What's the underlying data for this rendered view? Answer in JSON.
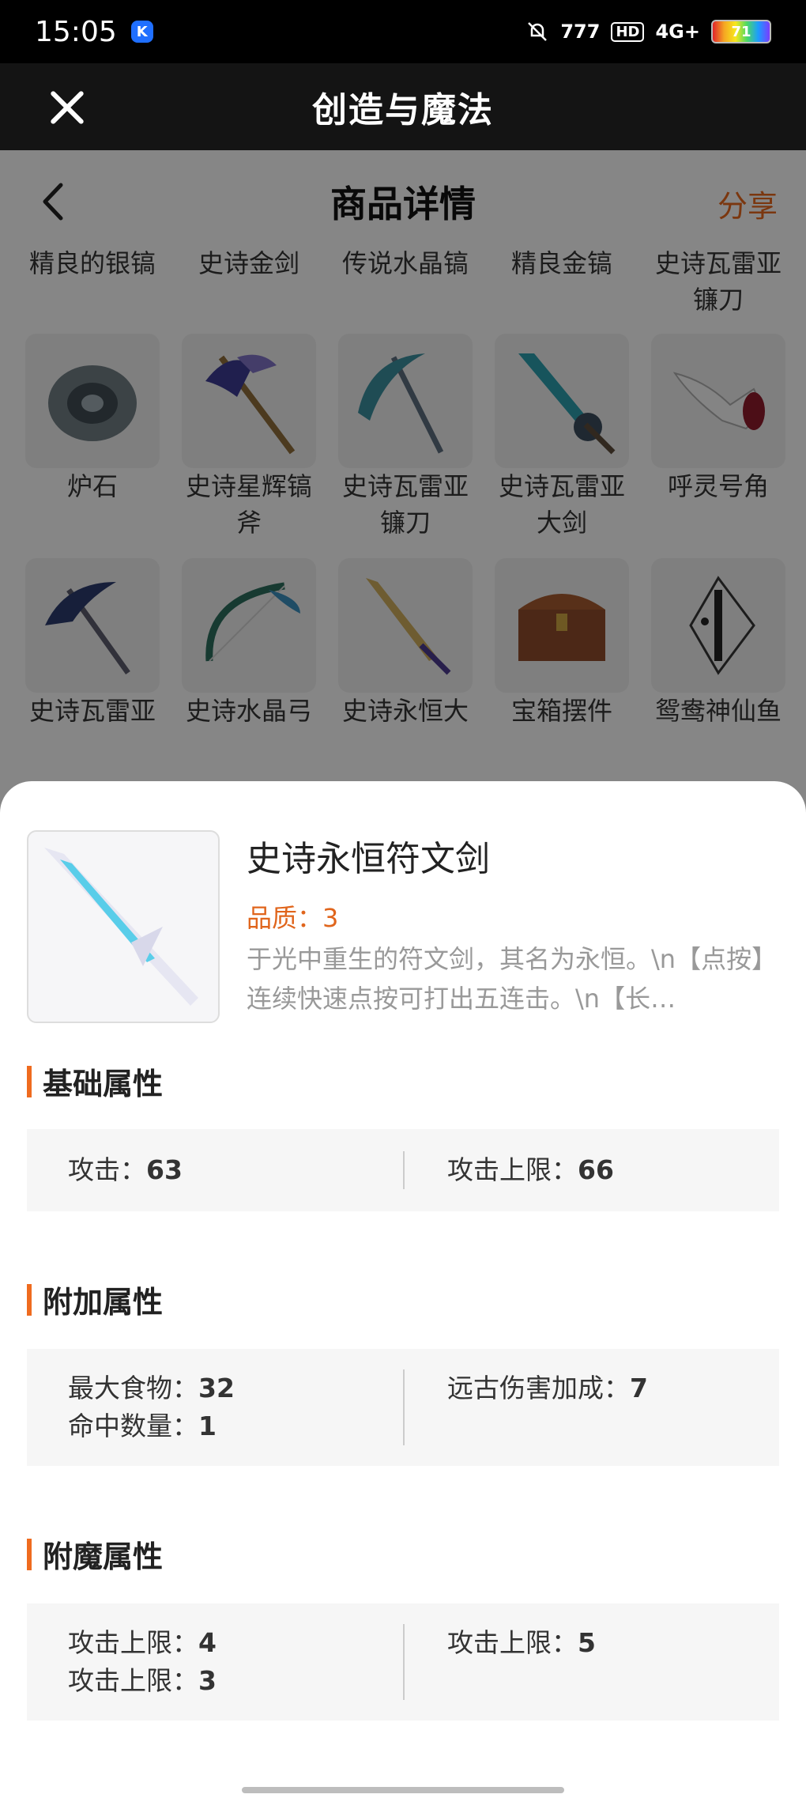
{
  "status_bar": {
    "time": "15:05",
    "app_badge": "K",
    "hd": "HD",
    "network": "4G+",
    "battery": "71"
  },
  "title_bar": {
    "title": "创造与魔法"
  },
  "page_header": {
    "title": "商品详情",
    "share": "分享"
  },
  "grid": {
    "row0": [
      "精良的银镐",
      "史诗金剑",
      "传说水晶镐",
      "精良金镐",
      "史诗瓦雷亚镰刀"
    ],
    "row1": [
      "炉石",
      "史诗星辉镐斧",
      "史诗瓦雷亚镰刀",
      "史诗瓦雷亚大剑",
      "呼灵号角"
    ],
    "row2": [
      "史诗瓦雷亚",
      "史诗水晶弓",
      "史诗永恒大",
      "宝箱摆件",
      "鸳鸯神仙鱼"
    ]
  },
  "item": {
    "name": "史诗永恒符文剑",
    "quality": "品质：3",
    "description": "于光中重生的符文剑，其名为永恒。\\n【点按】连续快速点按可打出五连击。\\n【长…"
  },
  "sections": {
    "basic": {
      "title": "基础属性",
      "left": [
        {
          "label": "攻击：",
          "value": "63"
        }
      ],
      "right": [
        {
          "label": "攻击上限：",
          "value": "66"
        }
      ]
    },
    "extra": {
      "title": "附加属性",
      "left": [
        {
          "label": "最大食物：",
          "value": "32"
        },
        {
          "label": "命中数量：",
          "value": "1"
        }
      ],
      "right": [
        {
          "label": "远古伤害加成：",
          "value": "7"
        }
      ]
    },
    "enchant": {
      "title": "附魔属性",
      "left": [
        {
          "label": "攻击上限：",
          "value": "4"
        },
        {
          "label": "攻击上限：",
          "value": "3"
        }
      ],
      "right": [
        {
          "label": "攻击上限：",
          "value": "5"
        }
      ]
    }
  },
  "colors": {
    "accent": "#e0651c",
    "section_bar": "#ef6b1f"
  },
  "icons": [
    "close-icon",
    "back-arrow-icon",
    "mute-bell-icon",
    "signal-icon",
    "battery-icon",
    "sword-icon",
    "pickaxe-icon",
    "scythe-icon",
    "hearthstone-icon",
    "horn-icon",
    "axe-icon",
    "bow-icon",
    "chest-icon",
    "fish-icon"
  ]
}
